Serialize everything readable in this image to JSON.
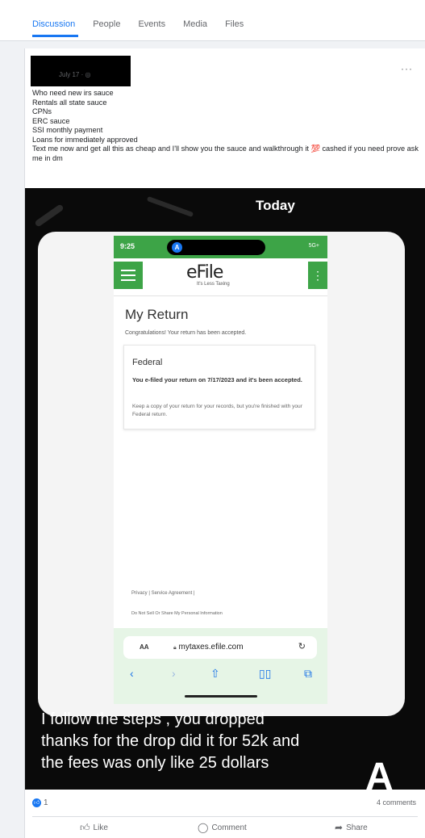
{
  "tabs": [
    "Discussion",
    "People",
    "Events",
    "Media",
    "Files"
  ],
  "post": {
    "date": "July 17 · ",
    "more": "···",
    "lines": [
      "Who need new irs sauce",
      "Rentals all state sauce",
      "CPNs",
      "ERC sauce",
      "SSI monthly payment",
      "Loans for immediately approved",
      "Text me now and get all this as cheap and I'll show you the sauce and walkthrough it 💯 cashed if you need prove ask me in dm"
    ]
  },
  "media": {
    "today": "Today",
    "phone": {
      "time": "9:25",
      "signal": "5G+",
      "logo": "eFile",
      "logo_sub": "It's Less Taxing",
      "title": "My Return",
      "congrats": "Congratulations! Your return has been accepted.",
      "fed_title": "Federal",
      "fed_msg": "You e-filed your return on 7/17/2023 and it's been accepted.",
      "fed_note": "Keep a copy of your return for your records, but you're finished with your Federal return.",
      "footer_links": "Privacy | Service Agreement |",
      "footer_dns": "Do Not Sell Or Share My Personal Information",
      "aa": "AA",
      "url": "mytaxes.efile.com"
    },
    "caption": [
      "I follow the steps , you dropped",
      "thanks for the drop did it for 52k and",
      "the fees was only like 25 dollars"
    ],
    "big_letter": "A"
  },
  "stats": {
    "reactions": "1",
    "comments": "4 comments"
  },
  "actions": {
    "like": "Like",
    "comment": "Comment",
    "share": "Share"
  },
  "colors": {
    "accent": "#1877f2",
    "efile_green": "#3da447"
  }
}
